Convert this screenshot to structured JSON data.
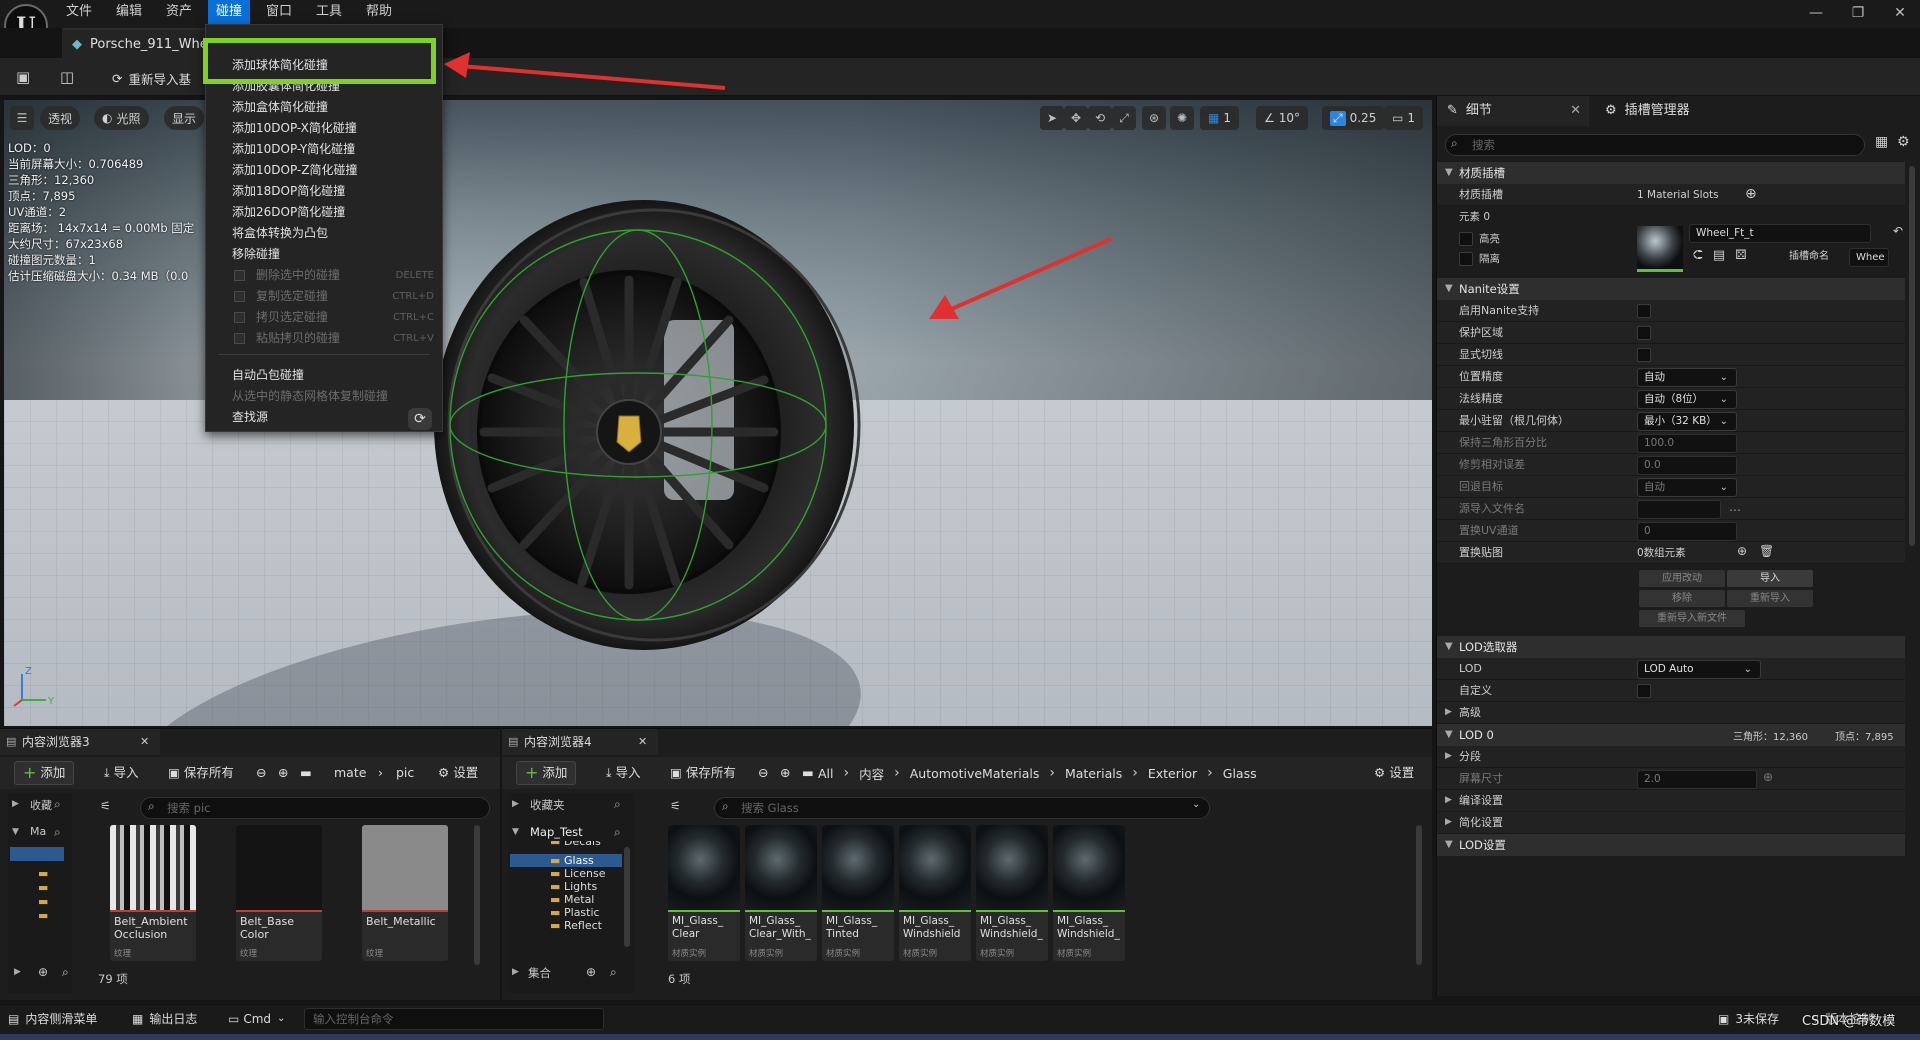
{
  "menu": {
    "logo": "U",
    "items": [
      "文件",
      "编辑",
      "资产",
      "碰撞",
      "窗口",
      "工具",
      "帮助"
    ],
    "active": "碰撞"
  },
  "asset_tab": {
    "title": "Porsche_911_Whe"
  },
  "toolbar": {
    "reimport": "重新导入基"
  },
  "collision_menu": {
    "items": [
      {
        "label": "添加球体简化碰撞",
        "enabled": true
      },
      {
        "label": "添加胶囊体简化碰撞",
        "enabled": true
      },
      {
        "label": "添加盒体简化碰撞",
        "enabled": true
      },
      {
        "label": "添加10DOP-X简化碰撞",
        "enabled": true
      },
      {
        "label": "添加10DOP-Y简化碰撞",
        "enabled": true
      },
      {
        "label": "添加10DOP-Z简化碰撞",
        "enabled": true
      },
      {
        "label": "添加18DOP简化碰撞",
        "enabled": true
      },
      {
        "label": "添加26DOP简化碰撞",
        "enabled": true
      },
      {
        "label": "将盒体转换为凸包",
        "enabled": true
      },
      {
        "label": "移除碰撞",
        "enabled": true
      },
      {
        "label": "删除选中的碰撞",
        "enabled": false,
        "shortcut": "DELETE"
      },
      {
        "label": "复制选定碰撞",
        "enabled": false,
        "shortcut": "CTRL+D"
      },
      {
        "label": "拷贝选定碰撞",
        "enabled": false,
        "shortcut": "CTRL+C"
      },
      {
        "label": "粘贴拷贝的碰撞",
        "enabled": false,
        "shortcut": "CTRL+V"
      },
      {
        "label": "自动凸包碰撞",
        "enabled": true
      },
      {
        "label": "从选中的静态网格体复制碰撞",
        "enabled": false
      },
      {
        "label": "查找源",
        "enabled": true
      }
    ]
  },
  "viewport": {
    "perspective": "透视",
    "lighting": "光照",
    "show": "显示",
    "grid_value": "1",
    "angle_value": "10°",
    "scale_value": "0.25",
    "camera_value": "1",
    "stats": [
      "LOD：0",
      "当前屏幕大小：0.706489",
      "三角形：12,360",
      "顶点：7,895",
      "UV通道：2",
      "距离场：  14x7x14 = 0.00Mb 固定",
      "大约尺寸：67x23x68",
      "碰撞图元数量：1",
      "估计压缩磁盘大小：0.34 MB（0.0"
    ]
  },
  "details": {
    "tab_details": "细节",
    "tab_slots": "插槽管理器",
    "search_placeholder": "搜索",
    "sections": {
      "material_slots": "材质插槽",
      "nanite": "Nanite设置",
      "lod_picker": "LOD选取器",
      "advanced": "高级",
      "lod0": "LOD 0",
      "sections": "分段",
      "build": "编译设置",
      "reduction": "简化设置",
      "lod_settings": "LOD设置"
    },
    "material_slots_label": "材质插槽",
    "material_slots_value": "1 Material Slots",
    "element0": "元素 0",
    "highlight": "高亮",
    "isolate": "隔离",
    "material_name": "Wheel_Ft_t",
    "slot_name_label": "插槽命名",
    "slot_name_value": "Whee",
    "nanite_props": [
      {
        "label": "启用Nanite支持",
        "dim": false,
        "kind": "check"
      },
      {
        "label": "保护区域",
        "dim": false,
        "kind": "check"
      },
      {
        "label": "显式切线",
        "dim": false,
        "kind": "check"
      },
      {
        "label": "位置精度",
        "dim": false,
        "kind": "combo",
        "value": "自动"
      },
      {
        "label": "法线精度",
        "dim": false,
        "kind": "combo",
        "value": "自动（8位）"
      },
      {
        "label": "最小驻留（根几何体）",
        "dim": false,
        "kind": "combo",
        "value": "最小（32 KB）"
      },
      {
        "label": "保持三角形百分比",
        "dim": true,
        "kind": "num",
        "value": "100.0"
      },
      {
        "label": "修剪相对误差",
        "dim": true,
        "kind": "num",
        "value": "0.0"
      },
      {
        "label": "回退目标",
        "dim": true,
        "kind": "combo",
        "value": "自动"
      },
      {
        "label": "源导入文件名",
        "dim": true,
        "kind": "file",
        "value": ""
      },
      {
        "label": "置换UV通道",
        "dim": true,
        "kind": "num",
        "value": "0"
      },
      {
        "label": "置换贴图",
        "dim": false,
        "kind": "array",
        "value": "0数组元素"
      }
    ],
    "buttons": {
      "apply": "应用改动",
      "import": "导入",
      "remove": "移除",
      "reimport": "重新导入",
      "reimport_new": "重新导入新文件"
    },
    "lod_label": "LOD",
    "lod_value": "LOD Auto",
    "custom_label": "自定义",
    "lod0_tris": "三角形：12,360",
    "lod0_verts": "顶点：7,895",
    "screen_size_label": "屏幕尺寸",
    "screen_size_value": "2.0"
  },
  "cb3": {
    "tab": "内容浏览器3",
    "add": "添加",
    "import": "导入",
    "save_all": "保存所有",
    "path": [
      "mate",
      "pic"
    ],
    "settings": "设置",
    "search_placeholder": "搜索 pic",
    "tree_collapsed": "收藏",
    "tree_root": "Ma",
    "items": [
      {
        "name": "Belt_Ambient Occlusion",
        "type": "纹理",
        "kind": "stripes"
      },
      {
        "name": "Belt_Base Color",
        "type": "纹理",
        "kind": "dark"
      },
      {
        "name": "Belt_Metallic",
        "type": "纹理",
        "kind": "gray"
      }
    ],
    "count": "79 项"
  },
  "cb4": {
    "tab": "内容浏览器4",
    "add": "添加",
    "import": "导入",
    "save_all": "保存所有",
    "path": [
      "All",
      "内容",
      "AutomotiveMaterials",
      "Materials",
      "Exterior",
      "Glass"
    ],
    "settings": "设置",
    "favorites": "收藏夹",
    "project": "Map_Test",
    "folders": [
      "Decals",
      "Glass",
      "License",
      "Lights",
      "Metal",
      "Plastic",
      "Reflect"
    ],
    "collections": "集合",
    "search_placeholder": "搜索 Glass",
    "items": [
      {
        "name": "MI_Glass_ Clear",
        "type": "材质实例"
      },
      {
        "name": "MI_Glass_ Clear_With_",
        "type": "材质实例"
      },
      {
        "name": "MI_Glass_ Tinted",
        "type": "材质实例"
      },
      {
        "name": "MI_Glass_ Windshield",
        "type": "材质实例"
      },
      {
        "name": "MI_Glass_ Windshield_",
        "type": "材质实例"
      },
      {
        "name": "MI_Glass_ Windshield_",
        "type": "材质实例"
      }
    ],
    "count": "6 项"
  },
  "statusbar": {
    "drawer": "内容侧滑菜单",
    "output_log": "输出日志",
    "cmd": "Cmd",
    "console_placeholder": "输入控制台命令",
    "unsaved": "3未保存",
    "source_control": "版本控制",
    "watermark": "CSDN @帝数模"
  },
  "colors": {
    "menu_active": "#0a70d8",
    "highlight_box": "#7ed321",
    "arrow": "#e03030",
    "collision_wire": "#2fa22f"
  }
}
